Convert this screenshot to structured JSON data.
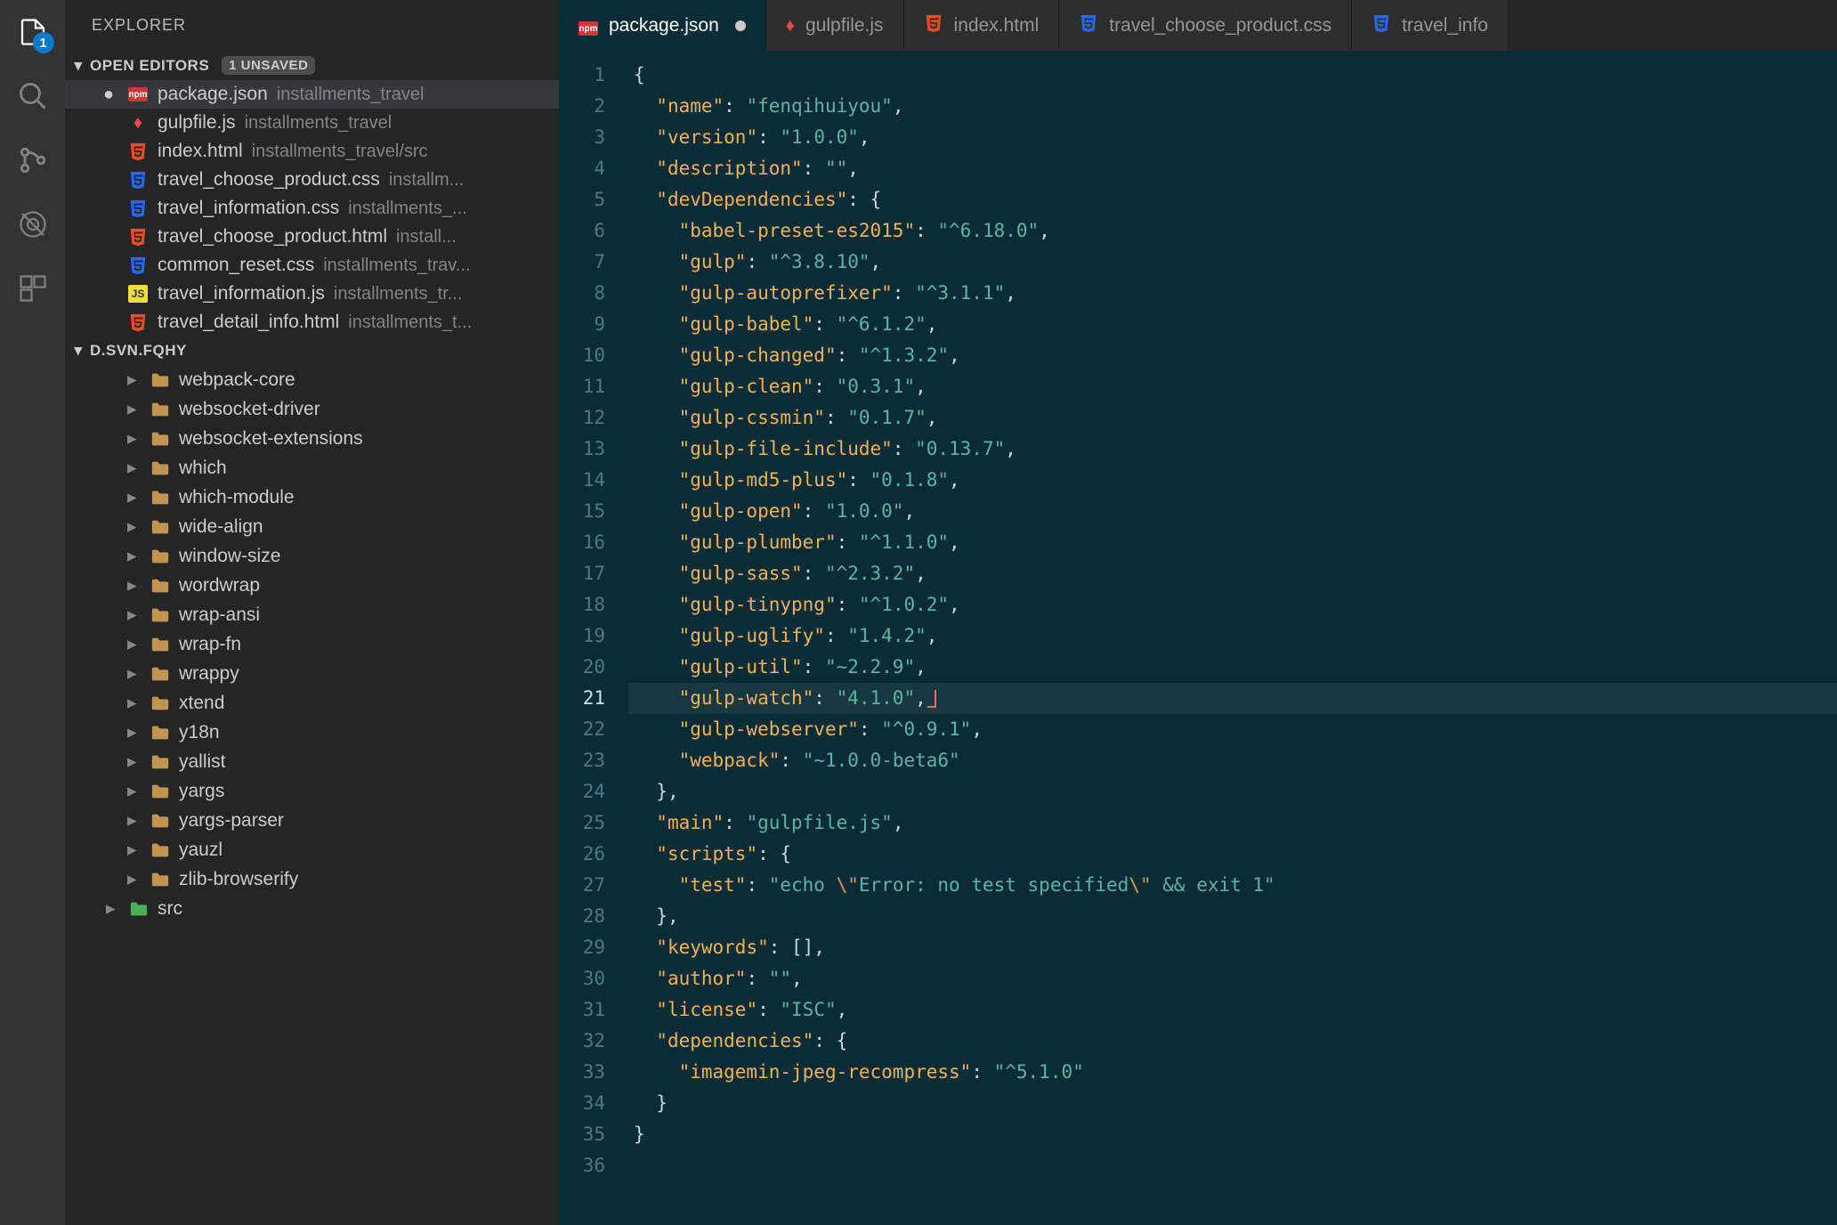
{
  "activity": {
    "badge": "1"
  },
  "sidebar": {
    "title": "EXPLORER",
    "openEditorsLabel": "OPEN EDITORS",
    "unsaved": "1 UNSAVED",
    "editors": [
      {
        "name": "package.json",
        "path": "installments_travel",
        "icon": "npm",
        "dirty": true,
        "selected": true
      },
      {
        "name": "gulpfile.js",
        "path": "installments_travel",
        "icon": "gulp"
      },
      {
        "name": "index.html",
        "path": "installments_travel/src",
        "icon": "html"
      },
      {
        "name": "travel_choose_product.css",
        "path": "installm...",
        "icon": "css"
      },
      {
        "name": "travel_information.css",
        "path": "installments_...",
        "icon": "css"
      },
      {
        "name": "travel_choose_product.html",
        "path": "install...",
        "icon": "html"
      },
      {
        "name": "common_reset.css",
        "path": "installments_trav...",
        "icon": "css"
      },
      {
        "name": "travel_information.js",
        "path": "installments_tr...",
        "icon": "js"
      },
      {
        "name": "travel_detail_info.html",
        "path": "installments_t...",
        "icon": "html"
      }
    ],
    "projectLabel": "D.SVN.FQHY",
    "tree": [
      "webpack-core",
      "websocket-driver",
      "websocket-extensions",
      "which",
      "which-module",
      "wide-align",
      "window-size",
      "wordwrap",
      "wrap-ansi",
      "wrap-fn",
      "wrappy",
      "xtend",
      "y18n",
      "yallist",
      "yargs",
      "yargs-parser",
      "yauzl",
      "zlib-browserify"
    ],
    "srcLabel": "src"
  },
  "tabs": [
    {
      "name": "package.json",
      "icon": "npm",
      "dirty": true,
      "active": true
    },
    {
      "name": "gulpfile.js",
      "icon": "gulp"
    },
    {
      "name": "index.html",
      "icon": "html"
    },
    {
      "name": "travel_choose_product.css",
      "icon": "css"
    },
    {
      "name": "travel_info",
      "icon": "css",
      "cut": true
    }
  ],
  "code": {
    "currentLine": 21,
    "lines": [
      [
        {
          "t": "punc",
          "v": "{"
        }
      ],
      [
        {
          "t": "sp",
          "v": "  "
        },
        {
          "t": "key",
          "v": "\"name\""
        },
        {
          "t": "punc",
          "v": ": "
        },
        {
          "t": "str",
          "v": "\"fenqihuiyou\""
        },
        {
          "t": "punc",
          "v": ","
        }
      ],
      [
        {
          "t": "sp",
          "v": "  "
        },
        {
          "t": "key",
          "v": "\"version\""
        },
        {
          "t": "punc",
          "v": ": "
        },
        {
          "t": "str",
          "v": "\"1.0.0\""
        },
        {
          "t": "punc",
          "v": ","
        }
      ],
      [
        {
          "t": "sp",
          "v": "  "
        },
        {
          "t": "key",
          "v": "\"description\""
        },
        {
          "t": "punc",
          "v": ": "
        },
        {
          "t": "str",
          "v": "\"\""
        },
        {
          "t": "punc",
          "v": ","
        }
      ],
      [
        {
          "t": "sp",
          "v": "  "
        },
        {
          "t": "key",
          "v": "\"devDependencies\""
        },
        {
          "t": "punc",
          "v": ": {"
        }
      ],
      [
        {
          "t": "sp",
          "v": "    "
        },
        {
          "t": "key",
          "v": "\"babel-preset-es2015\""
        },
        {
          "t": "punc",
          "v": ": "
        },
        {
          "t": "str",
          "v": "\"^6.18.0\""
        },
        {
          "t": "punc",
          "v": ","
        }
      ],
      [
        {
          "t": "sp",
          "v": "    "
        },
        {
          "t": "key",
          "v": "\"gulp\""
        },
        {
          "t": "punc",
          "v": ": "
        },
        {
          "t": "str",
          "v": "\"^3.8.10\""
        },
        {
          "t": "punc",
          "v": ","
        }
      ],
      [
        {
          "t": "sp",
          "v": "    "
        },
        {
          "t": "key",
          "v": "\"gulp-autoprefixer\""
        },
        {
          "t": "punc",
          "v": ": "
        },
        {
          "t": "str",
          "v": "\"^3.1.1\""
        },
        {
          "t": "punc",
          "v": ","
        }
      ],
      [
        {
          "t": "sp",
          "v": "    "
        },
        {
          "t": "key",
          "v": "\"gulp-babel\""
        },
        {
          "t": "punc",
          "v": ": "
        },
        {
          "t": "str",
          "v": "\"^6.1.2\""
        },
        {
          "t": "punc",
          "v": ","
        }
      ],
      [
        {
          "t": "sp",
          "v": "    "
        },
        {
          "t": "key",
          "v": "\"gulp-changed\""
        },
        {
          "t": "punc",
          "v": ": "
        },
        {
          "t": "str",
          "v": "\"^1.3.2\""
        },
        {
          "t": "punc",
          "v": ","
        }
      ],
      [
        {
          "t": "sp",
          "v": "    "
        },
        {
          "t": "key",
          "v": "\"gulp-clean\""
        },
        {
          "t": "punc",
          "v": ": "
        },
        {
          "t": "str",
          "v": "\"0.3.1\""
        },
        {
          "t": "punc",
          "v": ","
        }
      ],
      [
        {
          "t": "sp",
          "v": "    "
        },
        {
          "t": "key",
          "v": "\"gulp-cssmin\""
        },
        {
          "t": "punc",
          "v": ": "
        },
        {
          "t": "str",
          "v": "\"0.1.7\""
        },
        {
          "t": "punc",
          "v": ","
        }
      ],
      [
        {
          "t": "sp",
          "v": "    "
        },
        {
          "t": "key",
          "v": "\"gulp-file-include\""
        },
        {
          "t": "punc",
          "v": ": "
        },
        {
          "t": "str",
          "v": "\"0.13.7\""
        },
        {
          "t": "punc",
          "v": ","
        }
      ],
      [
        {
          "t": "sp",
          "v": "    "
        },
        {
          "t": "key",
          "v": "\"gulp-md5-plus\""
        },
        {
          "t": "punc",
          "v": ": "
        },
        {
          "t": "str",
          "v": "\"0.1.8\""
        },
        {
          "t": "punc",
          "v": ","
        }
      ],
      [
        {
          "t": "sp",
          "v": "    "
        },
        {
          "t": "key",
          "v": "\"gulp-open\""
        },
        {
          "t": "punc",
          "v": ": "
        },
        {
          "t": "str",
          "v": "\"1.0.0\""
        },
        {
          "t": "punc",
          "v": ","
        }
      ],
      [
        {
          "t": "sp",
          "v": "    "
        },
        {
          "t": "key",
          "v": "\"gulp-plumber\""
        },
        {
          "t": "punc",
          "v": ": "
        },
        {
          "t": "str",
          "v": "\"^1.1.0\""
        },
        {
          "t": "punc",
          "v": ","
        }
      ],
      [
        {
          "t": "sp",
          "v": "    "
        },
        {
          "t": "key",
          "v": "\"gulp-sass\""
        },
        {
          "t": "punc",
          "v": ": "
        },
        {
          "t": "str",
          "v": "\"^2.3.2\""
        },
        {
          "t": "punc",
          "v": ","
        }
      ],
      [
        {
          "t": "sp",
          "v": "    "
        },
        {
          "t": "key",
          "v": "\"gulp-tinypng\""
        },
        {
          "t": "punc",
          "v": ": "
        },
        {
          "t": "str",
          "v": "\"^1.0.2\""
        },
        {
          "t": "punc",
          "v": ","
        }
      ],
      [
        {
          "t": "sp",
          "v": "    "
        },
        {
          "t": "key",
          "v": "\"gulp-uglify\""
        },
        {
          "t": "punc",
          "v": ": "
        },
        {
          "t": "str",
          "v": "\"1.4.2\""
        },
        {
          "t": "punc",
          "v": ","
        }
      ],
      [
        {
          "t": "sp",
          "v": "    "
        },
        {
          "t": "key",
          "v": "\"gulp-util\""
        },
        {
          "t": "punc",
          "v": ": "
        },
        {
          "t": "str",
          "v": "\"~2.2.9\""
        },
        {
          "t": "punc",
          "v": ","
        }
      ],
      [
        {
          "t": "sp",
          "v": "    "
        },
        {
          "t": "key",
          "v": "\"gulp-watch\""
        },
        {
          "t": "punc",
          "v": ": "
        },
        {
          "t": "str",
          "v": "\"4.1.0\""
        },
        {
          "t": "punc",
          "v": ","
        },
        {
          "t": "cursor",
          "v": ""
        }
      ],
      [
        {
          "t": "sp",
          "v": "    "
        },
        {
          "t": "key",
          "v": "\"gulp-webserver\""
        },
        {
          "t": "punc",
          "v": ": "
        },
        {
          "t": "str",
          "v": "\"^0.9.1\""
        },
        {
          "t": "punc",
          "v": ","
        }
      ],
      [
        {
          "t": "sp",
          "v": "    "
        },
        {
          "t": "key",
          "v": "\"webpack\""
        },
        {
          "t": "punc",
          "v": ": "
        },
        {
          "t": "str",
          "v": "\"~1.0.0-beta6\""
        }
      ],
      [
        {
          "t": "sp",
          "v": "  "
        },
        {
          "t": "punc",
          "v": "},"
        }
      ],
      [
        {
          "t": "sp",
          "v": "  "
        },
        {
          "t": "key",
          "v": "\"main\""
        },
        {
          "t": "punc",
          "v": ": "
        },
        {
          "t": "str",
          "v": "\"gulpfile.js\""
        },
        {
          "t": "punc",
          "v": ","
        }
      ],
      [
        {
          "t": "sp",
          "v": "  "
        },
        {
          "t": "key",
          "v": "\"scripts\""
        },
        {
          "t": "punc",
          "v": ": {"
        }
      ],
      [
        {
          "t": "sp",
          "v": "    "
        },
        {
          "t": "key",
          "v": "\"test\""
        },
        {
          "t": "punc",
          "v": ": "
        },
        {
          "t": "str",
          "v": "\"echo "
        },
        {
          "t": "esc",
          "v": "\\\""
        },
        {
          "t": "str",
          "v": "Error: no test specified"
        },
        {
          "t": "esc",
          "v": "\\\""
        },
        {
          "t": "str",
          "v": " && exit 1\""
        }
      ],
      [
        {
          "t": "sp",
          "v": "  "
        },
        {
          "t": "punc",
          "v": "},"
        }
      ],
      [
        {
          "t": "sp",
          "v": "  "
        },
        {
          "t": "key",
          "v": "\"keywords\""
        },
        {
          "t": "punc",
          "v": ": [],"
        }
      ],
      [
        {
          "t": "sp",
          "v": "  "
        },
        {
          "t": "key",
          "v": "\"author\""
        },
        {
          "t": "punc",
          "v": ": "
        },
        {
          "t": "str",
          "v": "\"\""
        },
        {
          "t": "punc",
          "v": ","
        }
      ],
      [
        {
          "t": "sp",
          "v": "  "
        },
        {
          "t": "key",
          "v": "\"license\""
        },
        {
          "t": "punc",
          "v": ": "
        },
        {
          "t": "str",
          "v": "\"ISC\""
        },
        {
          "t": "punc",
          "v": ","
        }
      ],
      [
        {
          "t": "sp",
          "v": "  "
        },
        {
          "t": "key",
          "v": "\"dependencies\""
        },
        {
          "t": "punc",
          "v": ": {"
        }
      ],
      [
        {
          "t": "sp",
          "v": "    "
        },
        {
          "t": "key",
          "v": "\"imagemin-jpeg-recompress\""
        },
        {
          "t": "punc",
          "v": ": "
        },
        {
          "t": "str",
          "v": "\"^5.1.0\""
        }
      ],
      [
        {
          "t": "sp",
          "v": "  "
        },
        {
          "t": "punc",
          "v": "}"
        }
      ],
      [
        {
          "t": "punc",
          "v": "}"
        }
      ],
      []
    ]
  }
}
